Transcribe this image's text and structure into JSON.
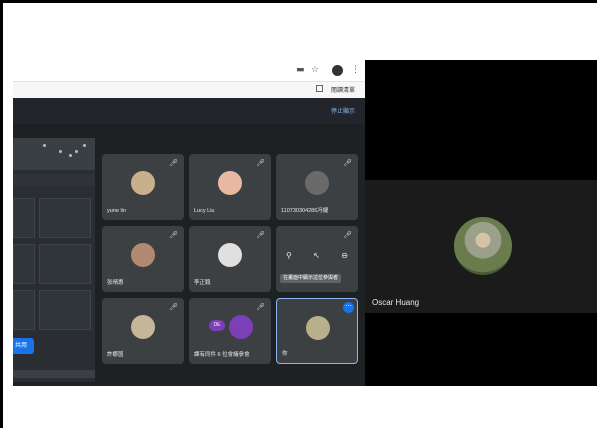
{
  "browser": {
    "icons": [
      "minus-icon",
      "star-icon",
      "avatar-icon",
      "kebab-icon"
    ],
    "bookmark_label": "閱讀清單"
  },
  "meet": {
    "stop_presenting_label": "停止顯示"
  },
  "left_panel": {
    "share_button_label": "共用"
  },
  "participants": [
    {
      "name": "yune lin",
      "avatar_color": "#c8b08a",
      "has_mic_icon": true
    },
    {
      "name": "Lucy Liu",
      "avatar_color": "#e8b8a0",
      "has_mic_icon": true
    },
    {
      "name": "110730304286冯婕",
      "avatar_color": "#6a6a6a",
      "has_mic_icon": true
    },
    {
      "name": "张晴惠",
      "avatar_color": "#b08a70",
      "has_mic_icon": true
    },
    {
      "name": "李正毅",
      "avatar_color": "#e0e0e0",
      "has_mic_icon": true
    },
    {
      "name": "",
      "avatar_color": "#3c4043",
      "has_mic_icon": true,
      "hover": true,
      "tooltip": "在畫面中顯示這位參與者"
    },
    {
      "name": "許娜茵",
      "avatar_color": "#c7b79a",
      "has_mic_icon": true
    },
    {
      "name": "課有同件 6 位會議參會",
      "avatar_color": "#7b3fb8",
      "has_mic_icon": true,
      "badge": "DE"
    },
    {
      "name": "你",
      "avatar_color": "#b8b08a",
      "has_mic_icon": false,
      "selected": true
    }
  ],
  "right_pane": {
    "speaker_name": "Oscar Huang"
  }
}
